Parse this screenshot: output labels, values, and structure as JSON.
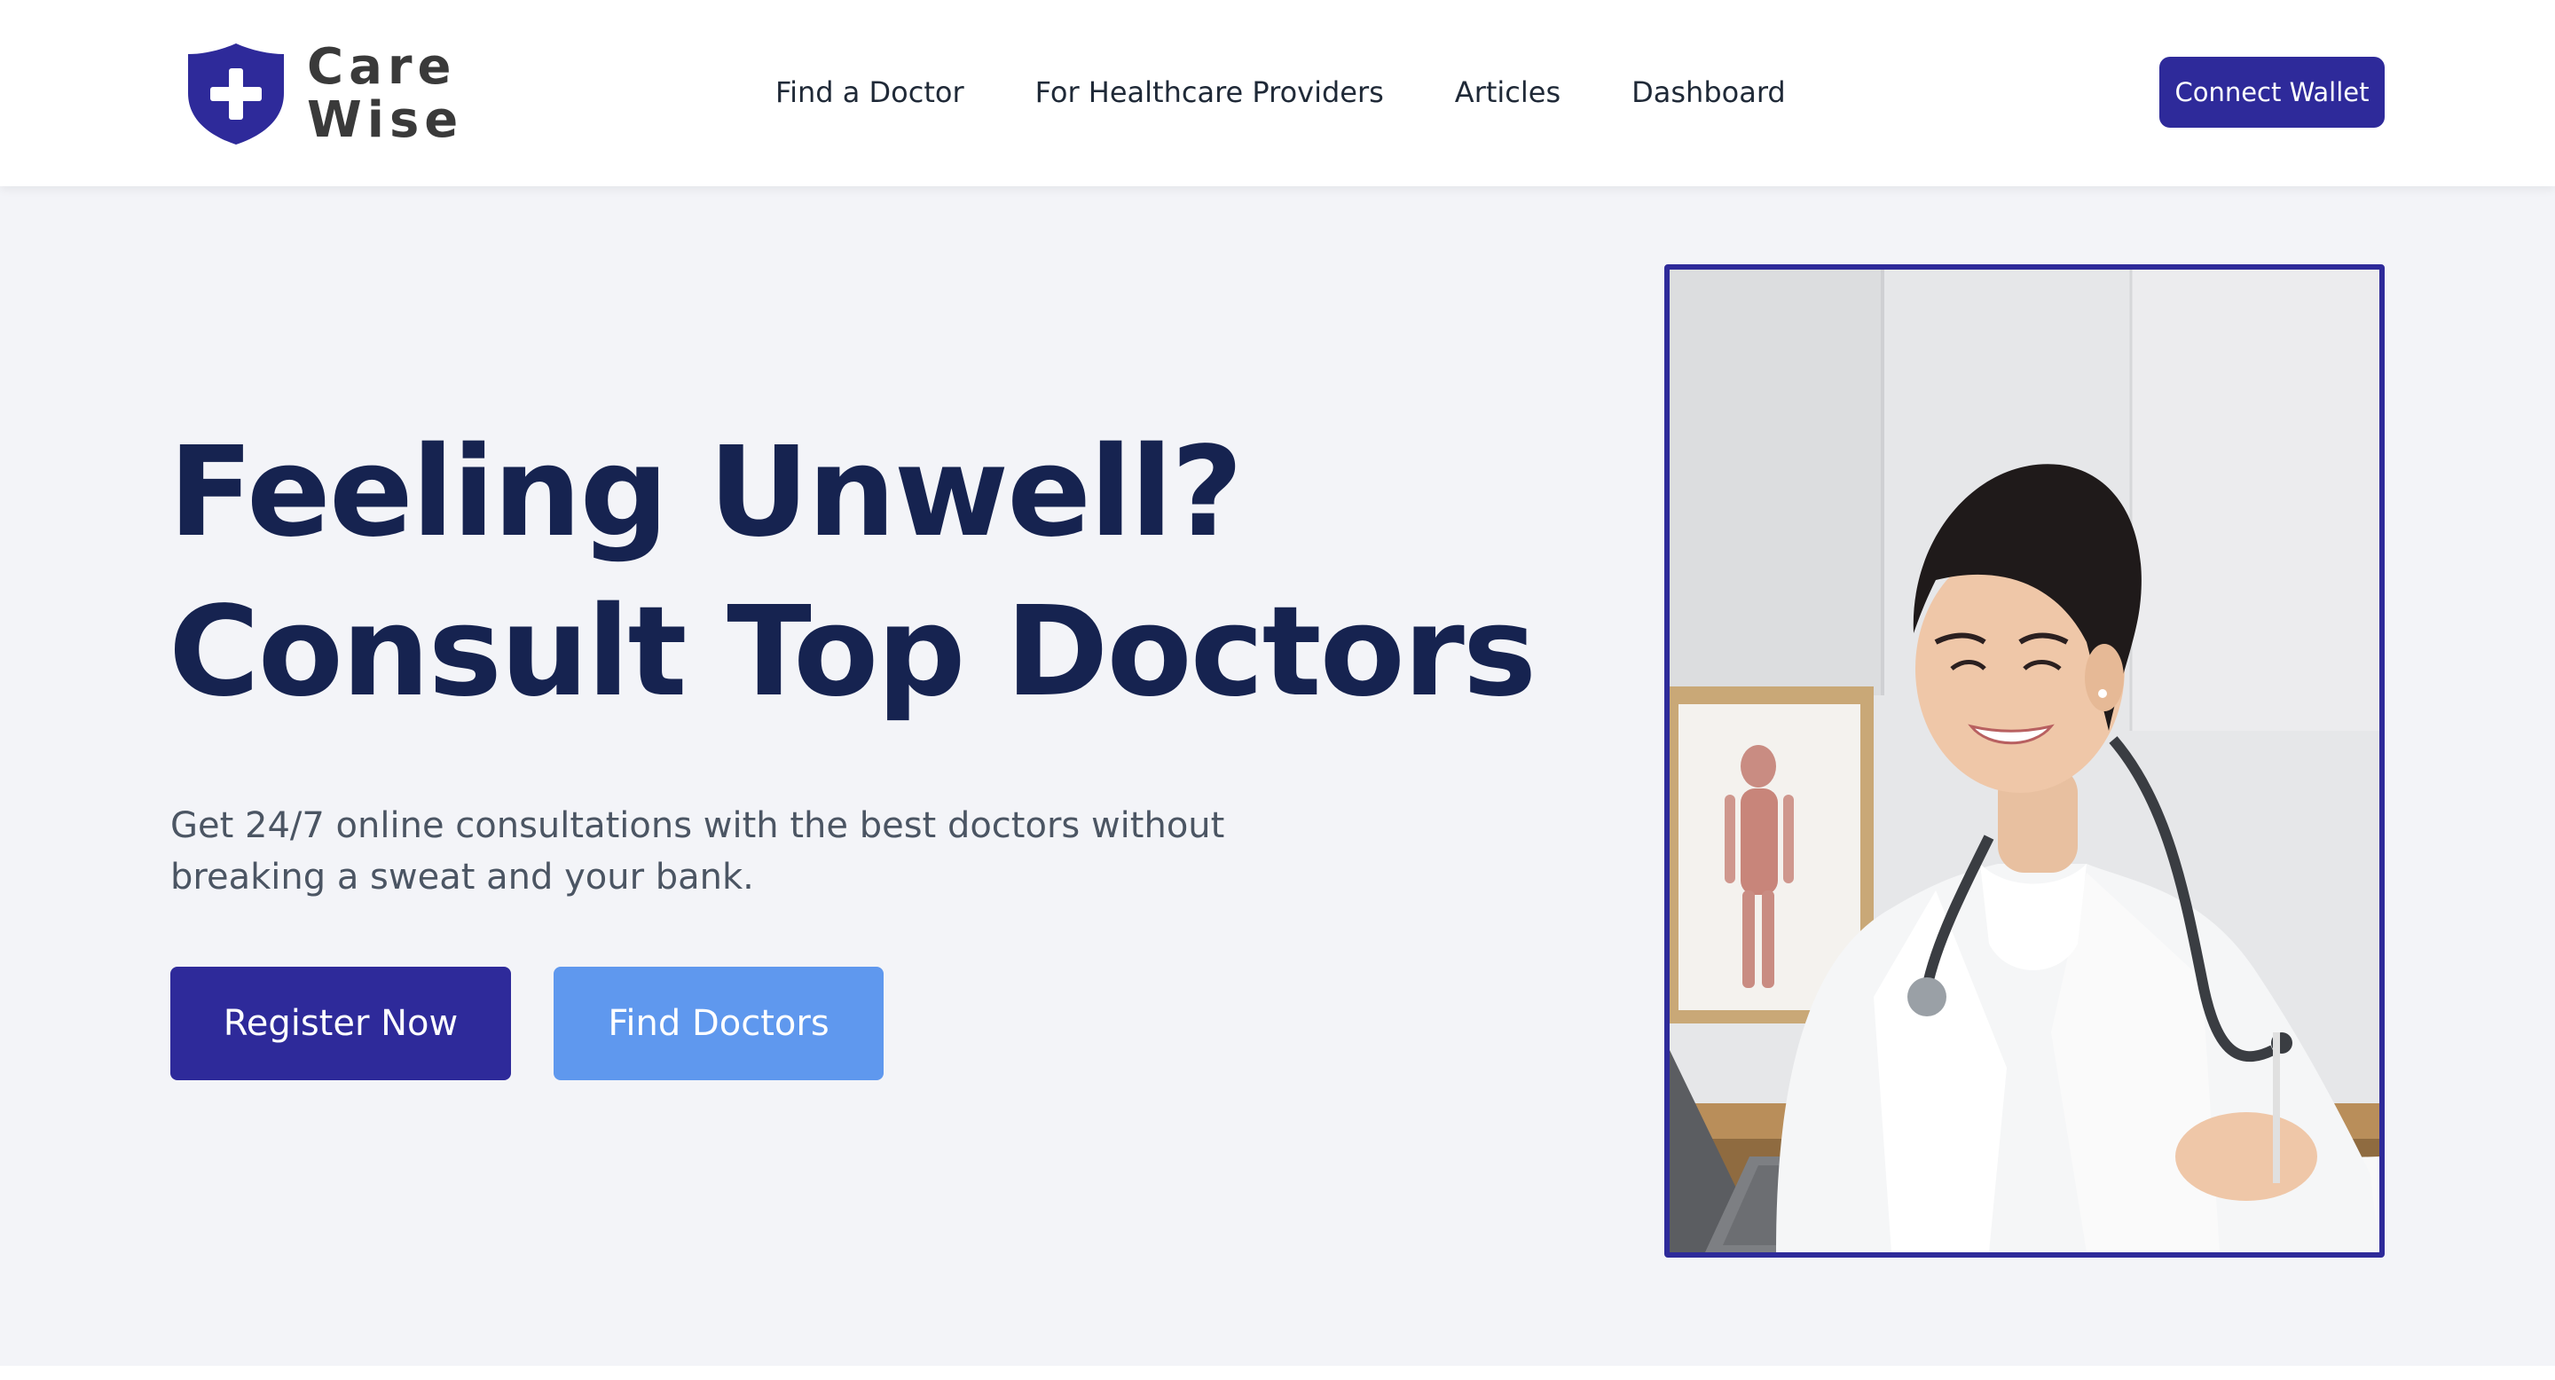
{
  "brand": {
    "name_line1": "Care",
    "name_line2": "Wise",
    "logo_icon": "shield-plus-icon",
    "color": "#2e2a9a"
  },
  "nav": {
    "items": [
      {
        "label": "Find a Doctor"
      },
      {
        "label": "For Healthcare Providers"
      },
      {
        "label": "Articles"
      },
      {
        "label": "Dashboard"
      }
    ]
  },
  "header": {
    "connect_wallet_label": "Connect Wallet"
  },
  "hero": {
    "headline_line1": "Feeling Unwell?",
    "headline_line2": "Consult Top Doctors",
    "subtext": "Get 24/7 online consultations with the best doctors without breaking a sweat and your bank.",
    "primary_cta": "Register Now",
    "secondary_cta": "Find Doctors",
    "image_description": "doctor-photo"
  },
  "colors": {
    "primary": "#2e2a9a",
    "secondary": "#5f98ee",
    "headline": "#162350",
    "background": "#f3f4f8"
  }
}
